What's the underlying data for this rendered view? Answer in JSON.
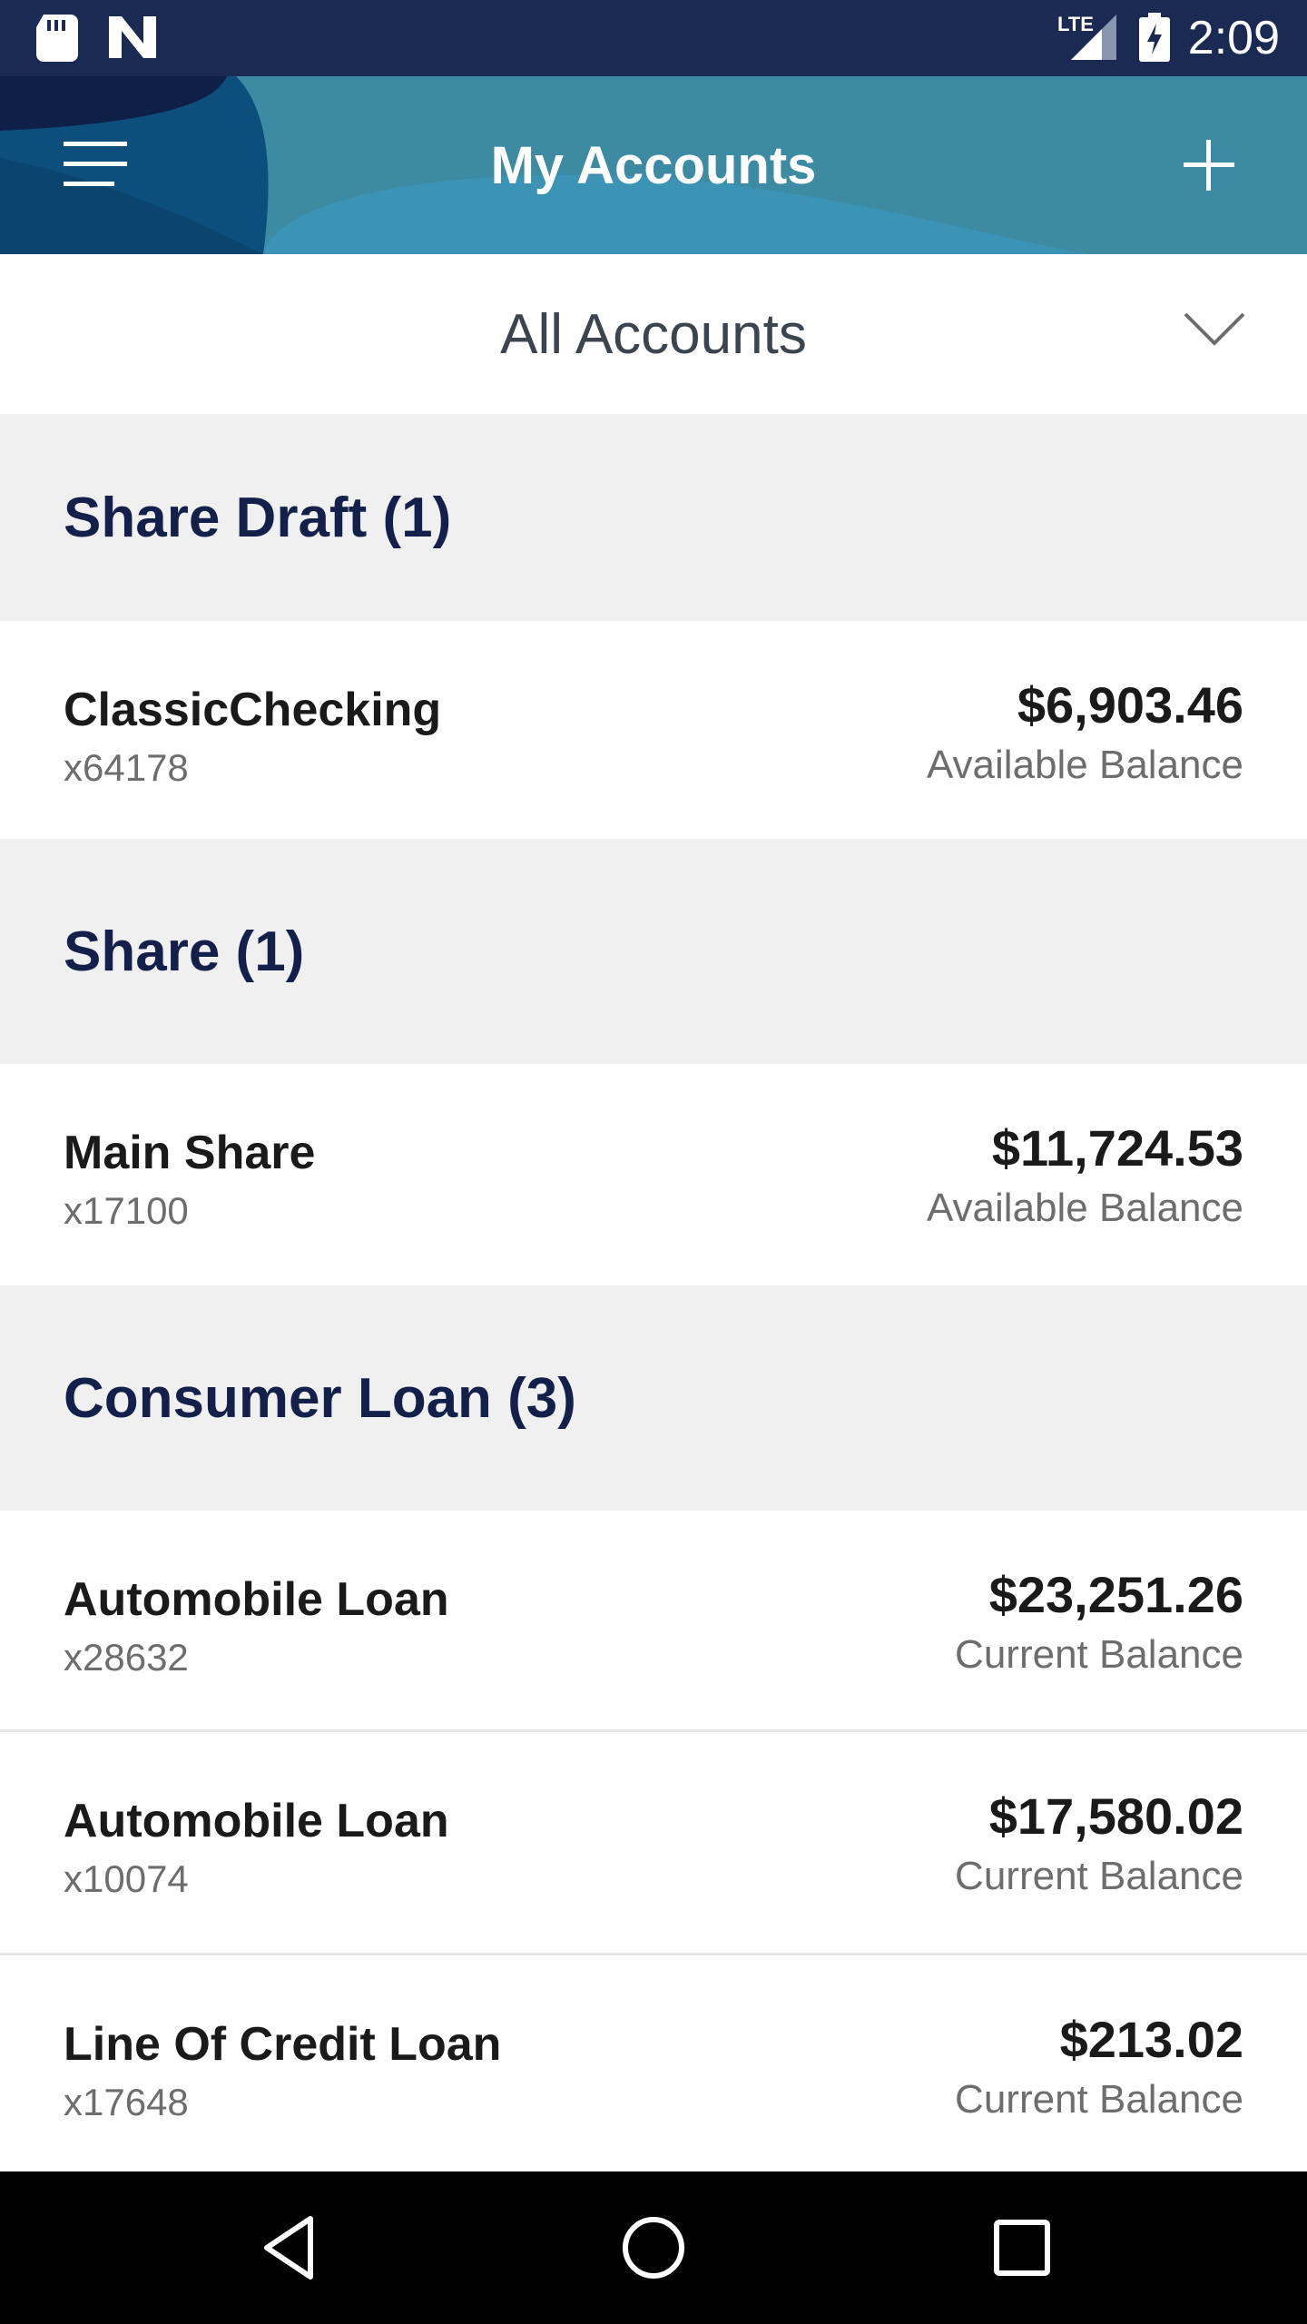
{
  "status_bar": {
    "time": "2:09",
    "network": "LTE",
    "icons": [
      "sd-card-icon",
      "n-notification-icon",
      "signal-icon",
      "battery-charging-icon"
    ]
  },
  "header": {
    "title": "My Accounts",
    "menu_icon": "hamburger-menu-icon",
    "add_icon": "plus-icon",
    "colors": {
      "dark": "#0f2048",
      "mid": "#0d4f7c",
      "light": "#3b97bd"
    }
  },
  "filter": {
    "label": "All Accounts",
    "icon": "chevron-down-icon"
  },
  "sections": [
    {
      "title": "Share Draft (1)",
      "accounts": [
        {
          "name": "ClassicChecking",
          "number": "x64178",
          "amount": "$6,903.46",
          "balance_label": "Available Balance"
        }
      ]
    },
    {
      "title": "Share (1)",
      "accounts": [
        {
          "name": "Main Share",
          "number": "x17100",
          "amount": "$11,724.53",
          "balance_label": "Available Balance"
        }
      ]
    },
    {
      "title": "Consumer Loan (3)",
      "accounts": [
        {
          "name": "Automobile Loan",
          "number": "x28632",
          "amount": "$23,251.26",
          "balance_label": "Current Balance"
        },
        {
          "name": "Automobile Loan",
          "number": "x10074",
          "amount": "$17,580.02",
          "balance_label": "Current Balance"
        },
        {
          "name": "Line Of Credit Loan",
          "number": "x17648",
          "amount": "$213.02",
          "balance_label": "Current Balance"
        }
      ]
    }
  ],
  "nav_bar": {
    "icons": [
      "back-icon",
      "home-icon",
      "recents-icon"
    ]
  }
}
